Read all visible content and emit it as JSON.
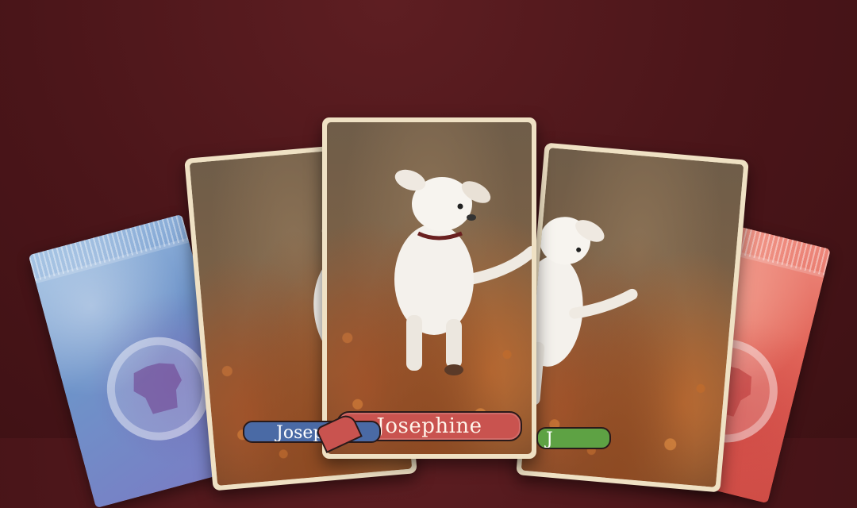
{
  "cards": {
    "center": {
      "name": "Josephine"
    },
    "left_banner_partial": "Josep",
    "right_banner_partial": "J"
  },
  "packs": [
    {
      "color": "blue",
      "accent": "#6e93c9",
      "icon": "dog-silhouette-icon"
    },
    {
      "color": "red",
      "accent": "#e2665a",
      "icon": "dog-silhouette-icon"
    }
  ],
  "colors": {
    "background": "#4a1519",
    "card_frame": "#efe1c4",
    "banner_red": "#c9534f",
    "banner_blue": "#4a6aa5",
    "banner_green": "#5ea244"
  }
}
